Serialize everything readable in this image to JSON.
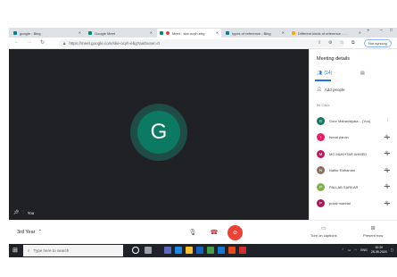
{
  "browser": {
    "tabs": [
      {
        "title": "google - Bing",
        "active": false
      },
      {
        "title": "Google Meet",
        "active": false
      },
      {
        "title": "Meet - ske-ocyh-ebg",
        "active": true
      },
      {
        "title": "types of reference - Bing",
        "active": false
      },
      {
        "title": "Different kinds of reference - ...",
        "active": false
      }
    ],
    "new_tab": "+",
    "url": "https://meet.google.com/ske-ocyh-ebg?authuser=0",
    "sync_label": "Not syncing"
  },
  "stage": {
    "avatar_letter": "G",
    "self_label": "You"
  },
  "panel": {
    "title": "Meeting details",
    "people_count": "(14)",
    "add_people": "Add people",
    "section_label": "IN CALL",
    "participants": [
      {
        "name": "Gour Mahavidyala... (You)",
        "initial": "G",
        "color": "#0c7a63",
        "status": "speaking"
      },
      {
        "name": "Ismat parvin",
        "initial": "I",
        "color": "#e91e63",
        "status": "muted"
      },
      {
        "name": "MD MUKHTAR AHMED",
        "initial": "M",
        "color": "#c2185b",
        "status": "muted"
      },
      {
        "name": "Naflur Rahaman",
        "initial": "N",
        "color": "#8d6e63",
        "status": "muted"
      },
      {
        "name": "PALLAB SARKAR",
        "initial": "P",
        "color": "#7cb342",
        "status": "muted"
      },
      {
        "name": "pulak mandal",
        "initial": "P",
        "color": "#ad1457",
        "status": "muted"
      }
    ]
  },
  "callbar": {
    "meeting_title": "3rd Year",
    "captions_label": "Turn on captions",
    "present_label": "Present now"
  },
  "taskbar": {
    "search_placeholder": "Type here to search",
    "language": "ENG",
    "time": "10:20",
    "date": "28-05-2020"
  },
  "colors": {
    "stage_bg": "#202124",
    "avatar": "#0c7a63",
    "accent": "#1a73e8",
    "hangup": "#ea4335"
  }
}
